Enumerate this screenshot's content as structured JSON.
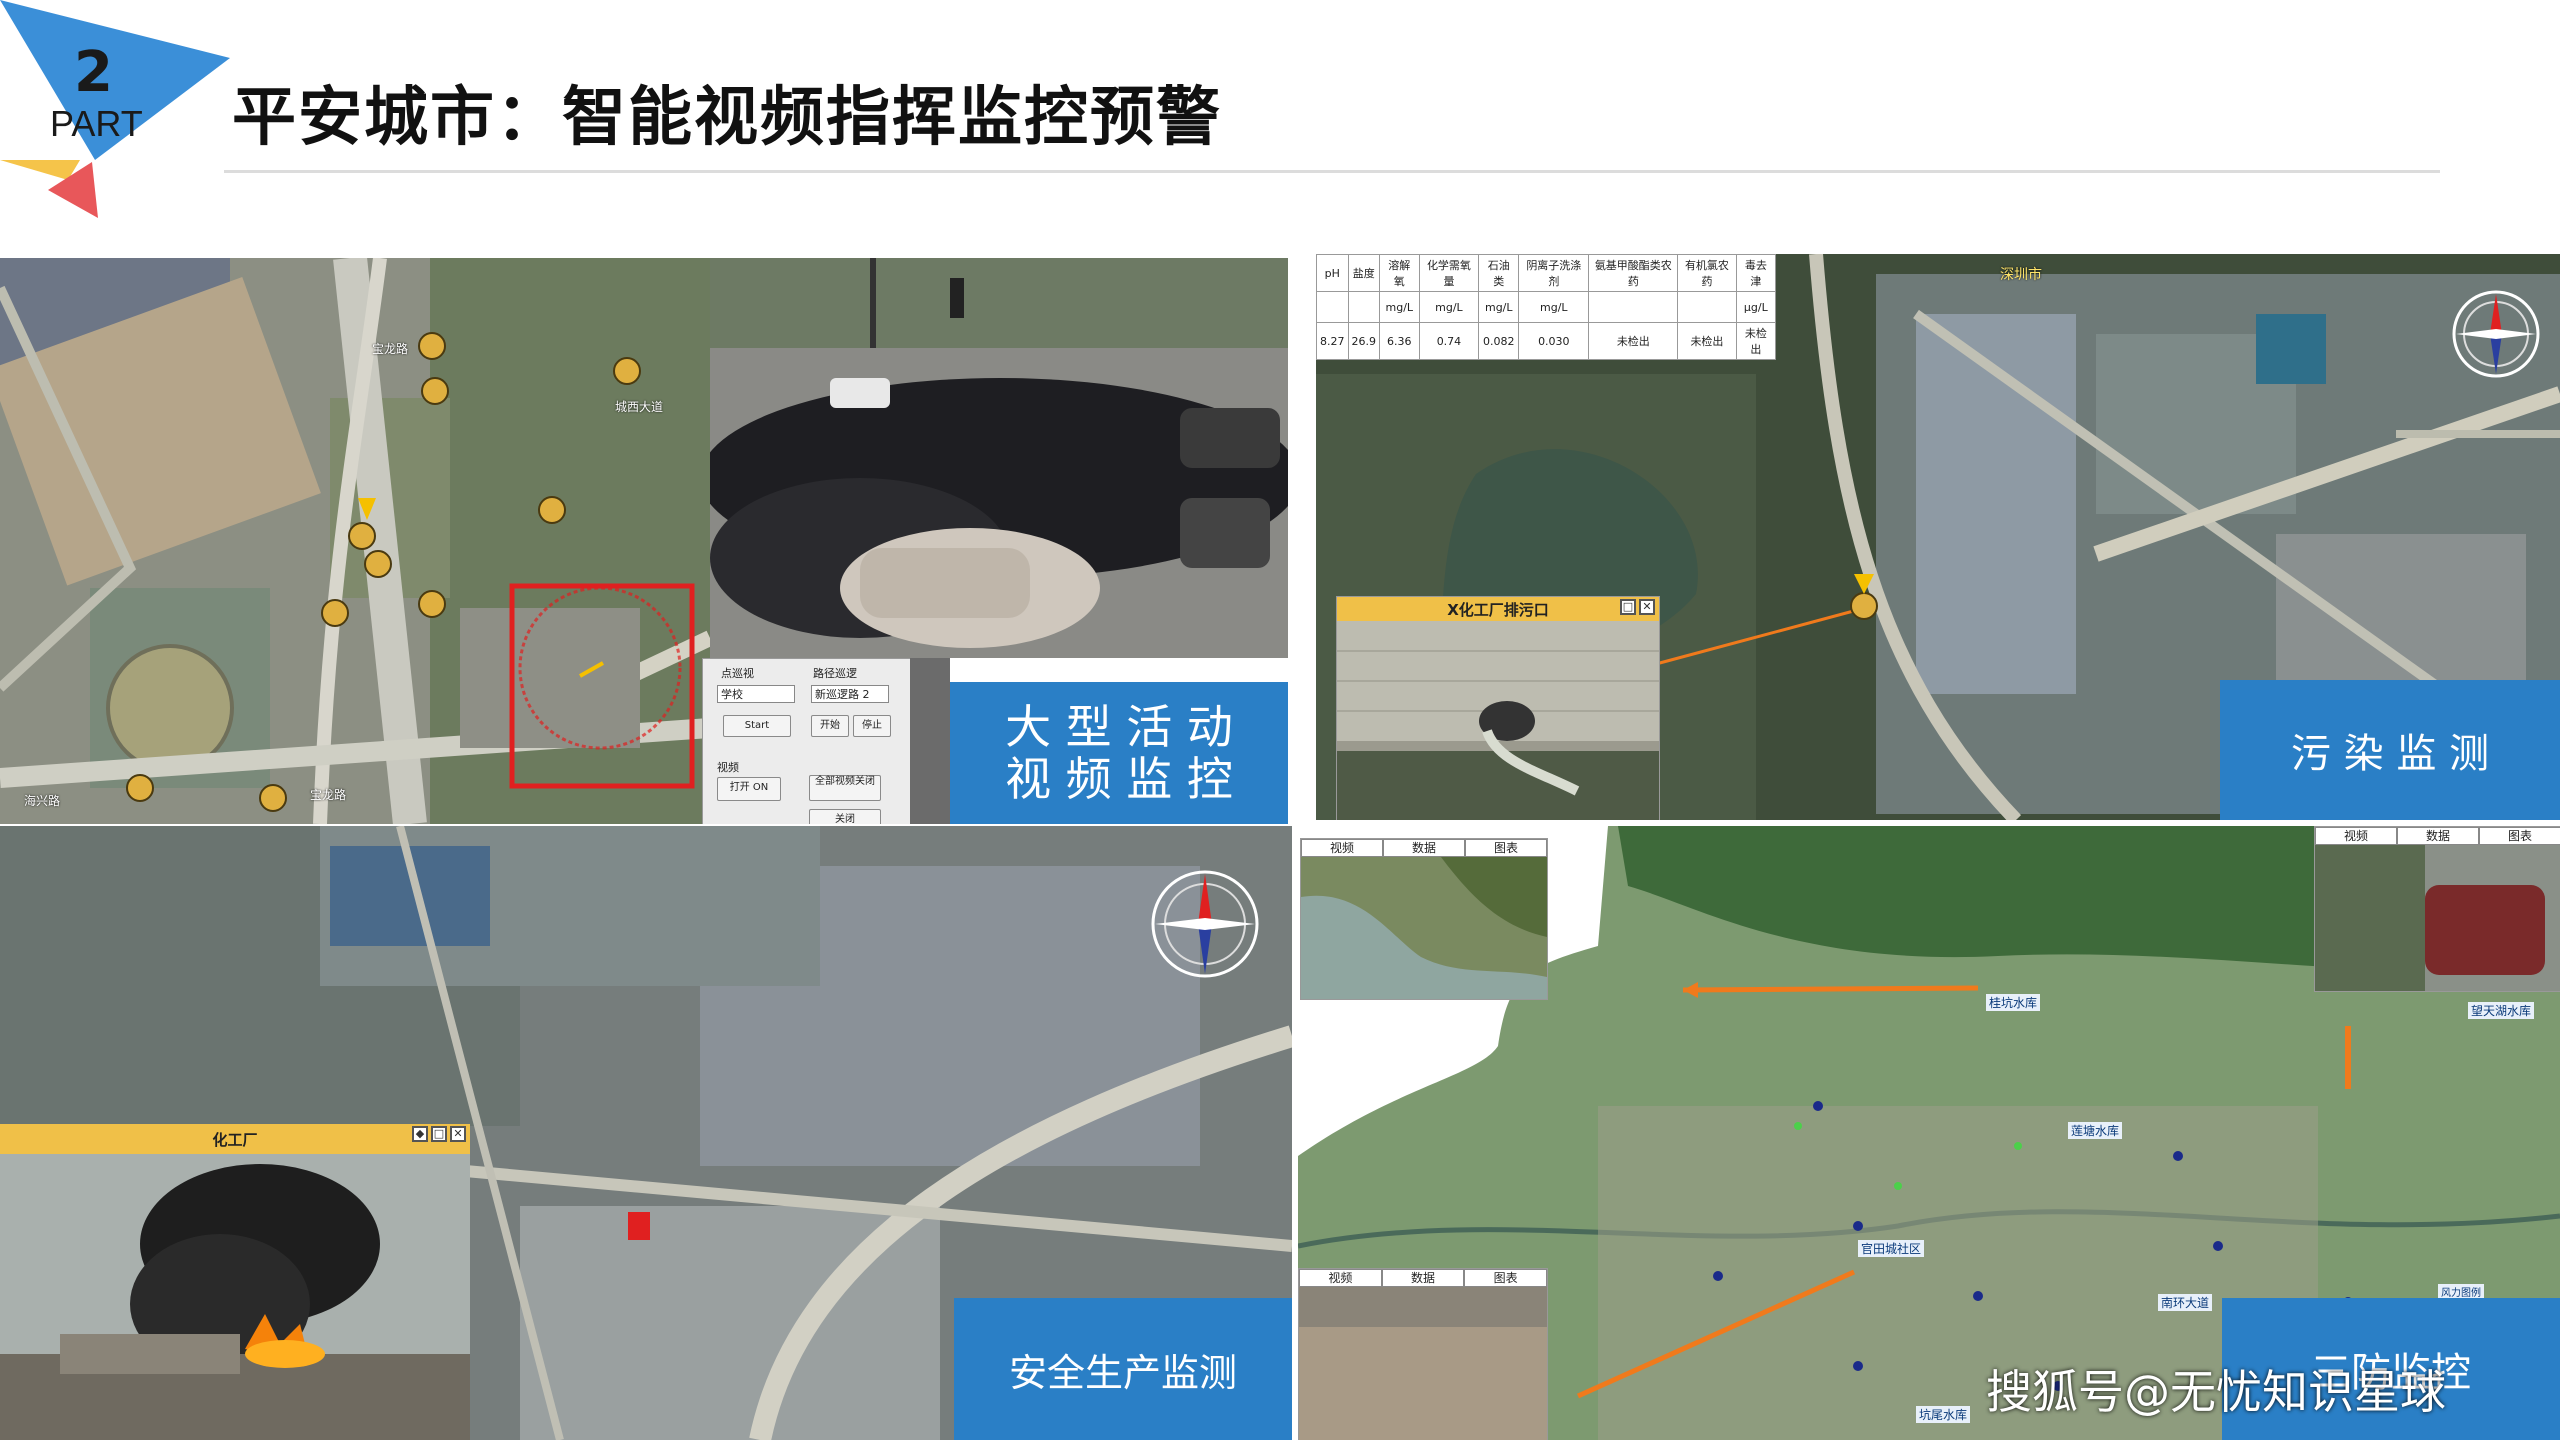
{
  "header": {
    "part_number": "2",
    "part_label": "PART",
    "title": "平安城市：智能视频指挥监控预警"
  },
  "colors": {
    "accent_blue": "#2a7fc6",
    "triangle_blue": "#3b8fd8",
    "triangle_yellow": "#f5c44a",
    "triangle_red": "#e8575a",
    "arrow_orange": "#f07a1c",
    "highlight_red": "#e02020"
  },
  "panels": {
    "crowd": {
      "label_line1": "大 型 活 动",
      "label_line2": "视 频 监 控",
      "map_labels": [
        "宝龙路",
        "城西大道",
        "海兴路",
        "宝龙路"
      ],
      "control": {
        "point_patrol": "点巡视",
        "path_patrol": "路径巡逻",
        "school_field": "学校",
        "new_path_field": "新巡逻路 2",
        "start_btn": "Start",
        "begin_btn": "开始",
        "stop_btn": "停止",
        "video_label": "视频",
        "open_btn": "打开 ON",
        "all_video_btn": "全部视频关闭",
        "close_btn": "关闭"
      }
    },
    "pollution": {
      "label": "污 染 监 测",
      "city_label": "深圳市",
      "popup_title": "X化工厂排污口",
      "table_headers": [
        "pH",
        "盐度",
        "溶解氧",
        "化学需氧量",
        "石油类",
        "阴离子洗涤剂",
        "氨基甲酸酯类农药",
        "有机氯农药",
        "毒去津"
      ],
      "table_units": [
        "",
        "",
        "mg/L",
        "mg/L",
        "mg/L",
        "mg/L",
        "",
        "",
        "μg/L"
      ],
      "table_values": [
        "8.27",
        "26.9",
        "6.36",
        "0.74",
        "0.082",
        "0.030",
        "未检出",
        "未检出",
        "未检出"
      ]
    },
    "safety": {
      "label": "安全生产监测",
      "popup_title": "化工厂"
    },
    "triple": {
      "label": "三防监控",
      "watermark": "搜狐号@无忧知识星球",
      "tabs": [
        "视频",
        "数据",
        "图表"
      ],
      "place_labels": [
        "桂坑水库",
        "望天湖水库",
        "莲塘水库",
        "官田城社区",
        "南环大道",
        "坑尾水库",
        "风力图例"
      ]
    }
  }
}
